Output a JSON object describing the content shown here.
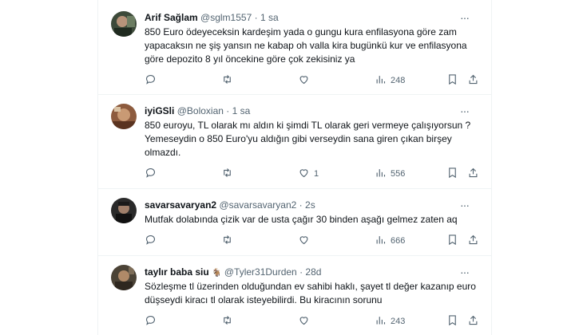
{
  "tweets": [
    {
      "name": "Arif Sağlam",
      "handle": "@sglm1557",
      "time": "1 sa",
      "text": "850 Euro ödeyeceksin kardeşim yada o gungu kura enfilasyona göre zam yapacaksın ne şiş yansın ne kabap oh valla kira bugünkü kur ve enfilasyona göre depozito 8 yıl öncekine göre çok zekisiniz ya",
      "reply_count": "",
      "retweet_count": "",
      "like_count": "",
      "view_count": "248"
    },
    {
      "name": "iyiGSli",
      "handle": "@Boloxian",
      "time": "1 sa",
      "text": "850 euroyu, TL olarak mı aldın ki şimdi TL olarak geri vermeye çalışıyorsun ? Yemeseydin o 850 Euro'yu aldığın gibi verseydin sana giren çıkan birşey olmazdı.",
      "reply_count": "",
      "retweet_count": "",
      "like_count": "1",
      "view_count": "556"
    },
    {
      "name": "savarsavaryan2",
      "handle": "@savarsavaryan2",
      "time": "2s",
      "text": "Mutfak dolabında çizik var de usta çağır 30 binden aşağı gelmez zaten aq",
      "reply_count": "",
      "retweet_count": "",
      "like_count": "",
      "view_count": "666"
    },
    {
      "name": "taylır baba siu",
      "name_badge": "🐐",
      "handle": "@Tyler31Durden",
      "time": "28d",
      "text": "Sözleşme tl üzerinden olduğundan ev sahibi haklı, şayet tl değer kazanıp euro düşseydi kiracı tl olarak isteyebilirdi. Bu kiracının sorunu",
      "reply_count": "",
      "retweet_count": "",
      "like_count": "",
      "view_count": "243"
    }
  ],
  "separator": "·",
  "more_label": "···",
  "colors": {
    "text": "#0f1419",
    "secondary": "#536471",
    "border": "#eff3f4"
  },
  "icons": [
    "reply-icon",
    "retweet-icon",
    "like-icon",
    "views-icon",
    "bookmark-icon",
    "share-icon",
    "more-icon"
  ]
}
